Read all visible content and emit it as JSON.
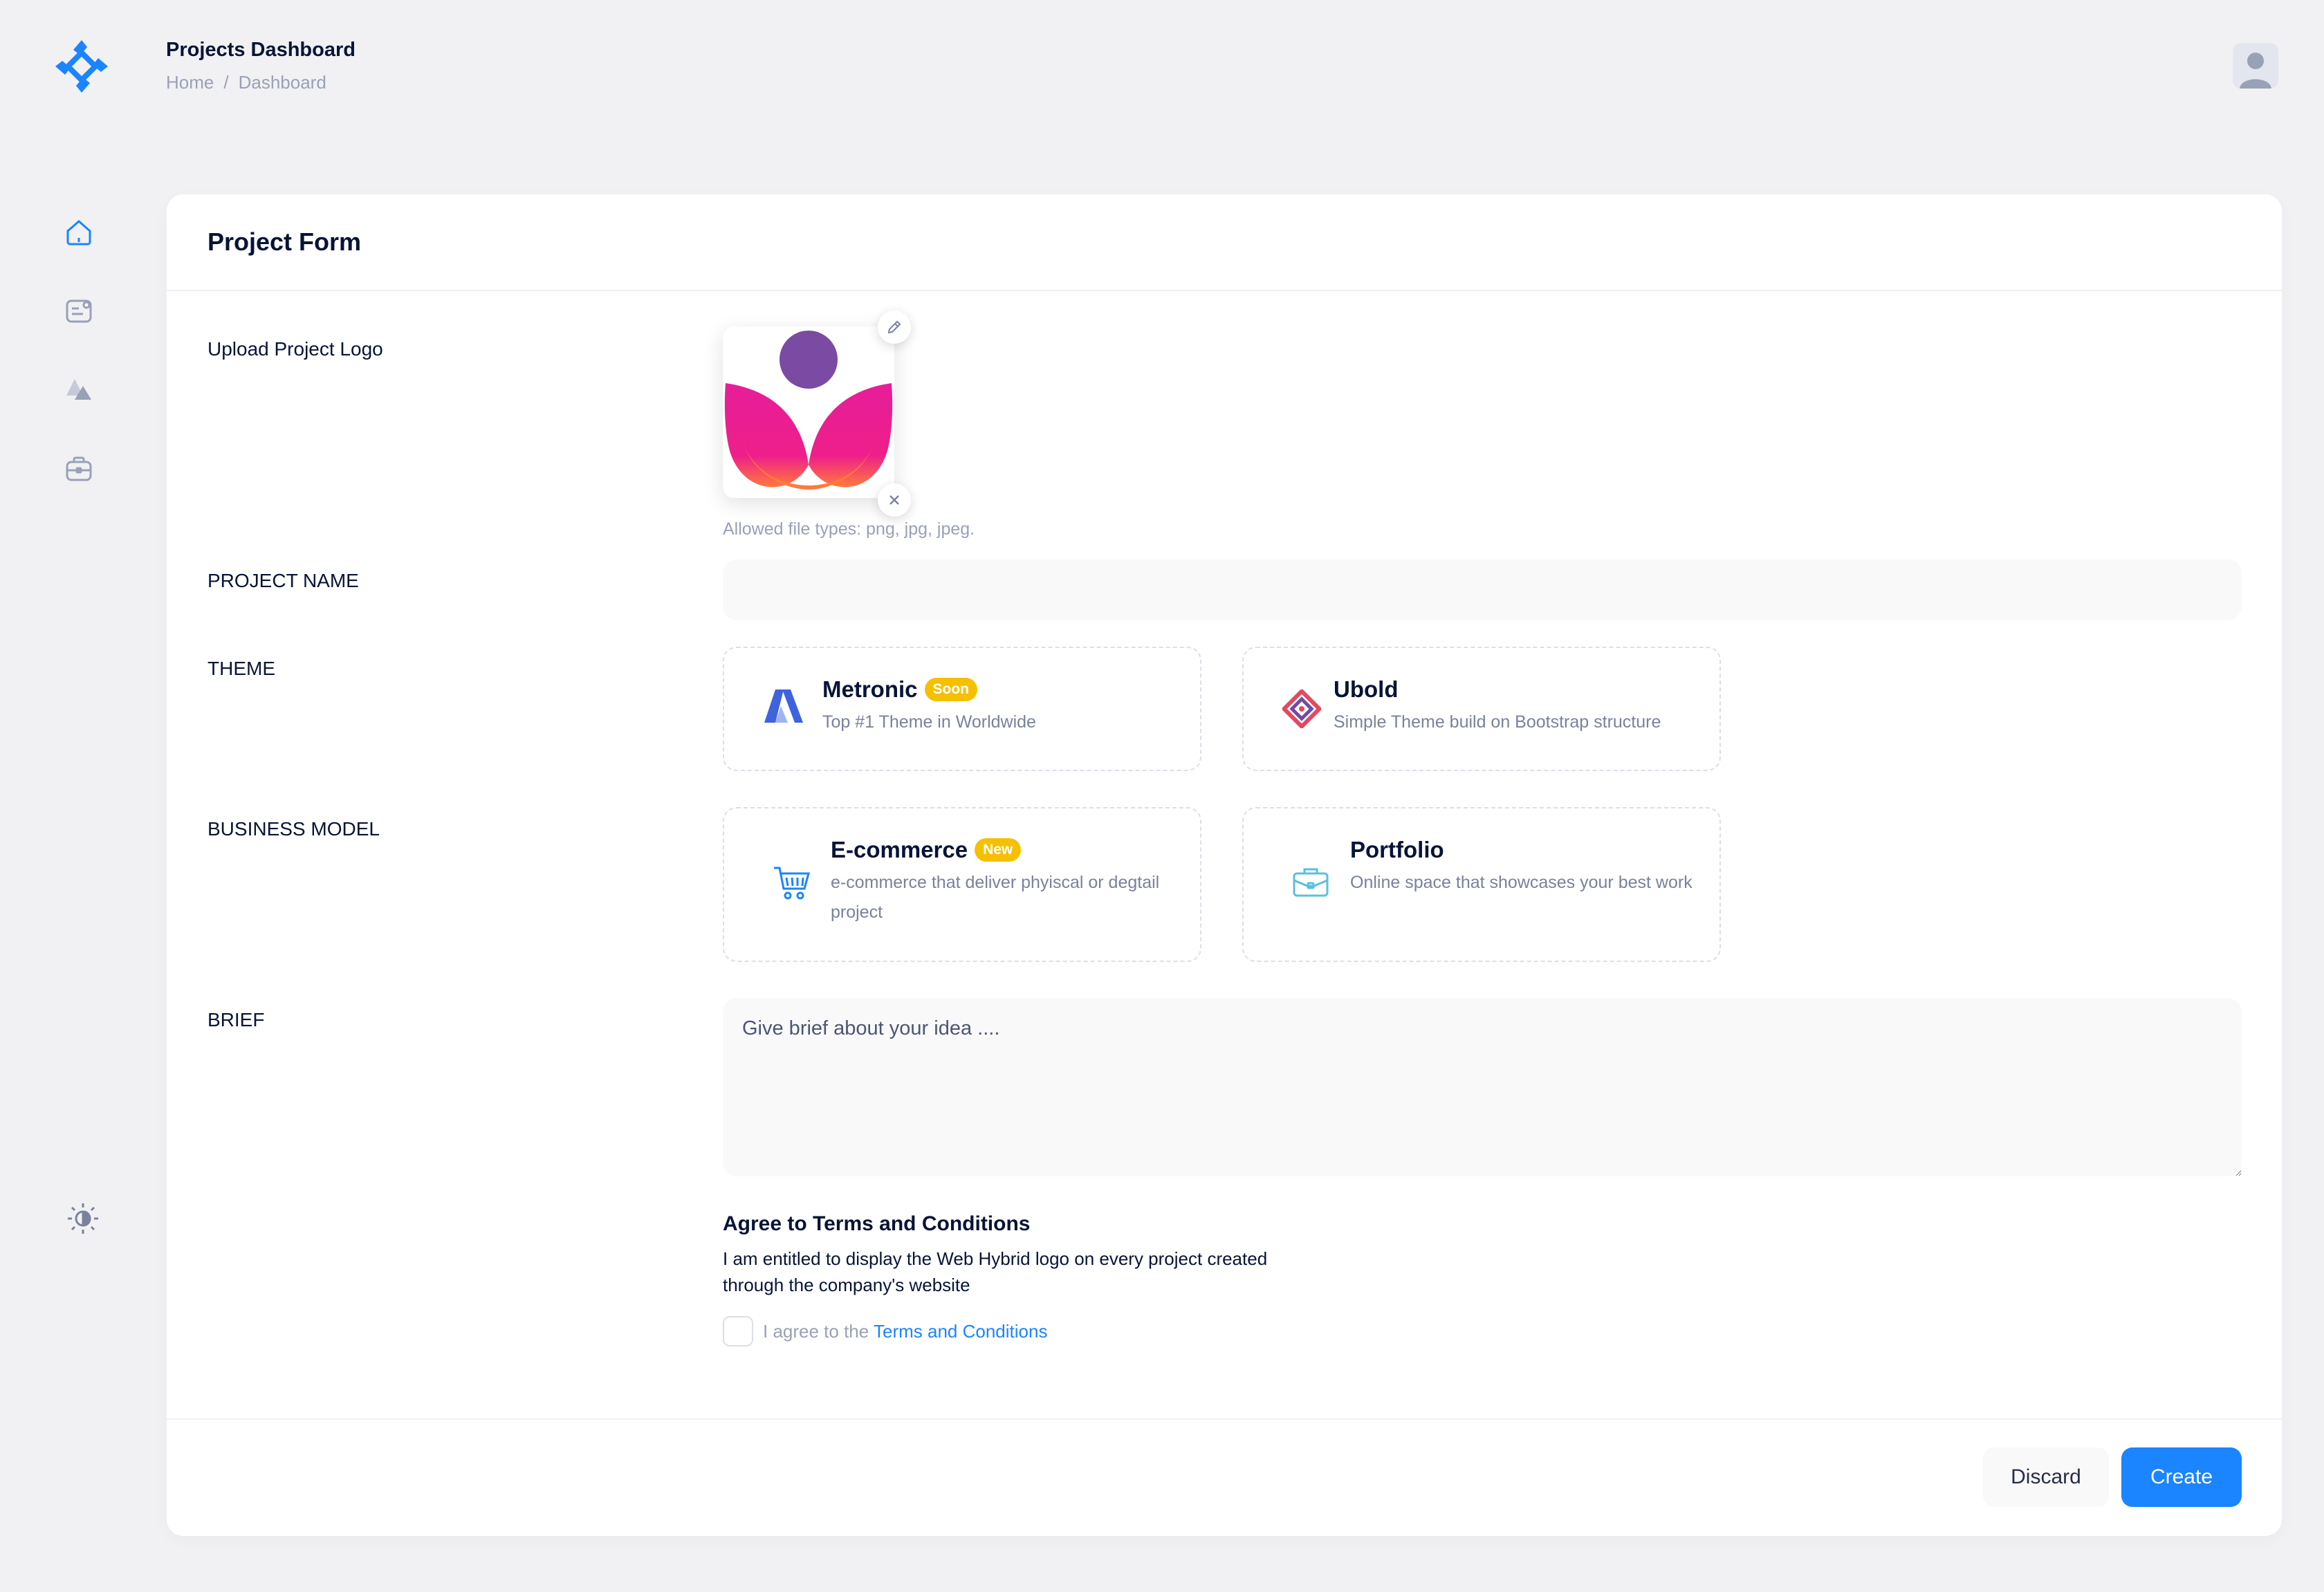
{
  "header": {
    "title": "Projects Dashboard",
    "breadcrumb": [
      "Home",
      "/",
      "Dashboard"
    ]
  },
  "sidebar": {
    "icons": [
      "home-icon",
      "profile-card-icon",
      "shapes-icon",
      "briefcase-icon"
    ],
    "theme_toggle_icon": "sun-icon"
  },
  "form": {
    "title": "Project Form",
    "upload": {
      "label": "Upload Project Logo",
      "hint": "Allowed file types: png, jpg, jpeg."
    },
    "project_name": {
      "label": "PROJECT NAME",
      "value": "",
      "placeholder": ""
    },
    "theme": {
      "label": "THEME",
      "options": [
        {
          "name": "Metronic",
          "badge": "Soon",
          "description": "Top #1 Theme in Worldwide",
          "icon": "metronic-logo-icon"
        },
        {
          "name": "Ubold",
          "badge": "",
          "description": "Simple Theme build on Bootstrap structure",
          "icon": "ubold-logo-icon"
        }
      ]
    },
    "business_model": {
      "label": "BUSINESS MODEL",
      "options": [
        {
          "name": "E-commerce",
          "badge": "New",
          "description": "e-commerce that deliver phyiscal or degtail project",
          "icon": "shopping-cart-icon"
        },
        {
          "name": "Portfolio",
          "badge": "",
          "description": "Online space that showcases your best work",
          "icon": "briefcase-icon"
        }
      ]
    },
    "brief": {
      "label": "BRIEF",
      "placeholder": "Give brief about your idea ...."
    },
    "terms": {
      "title": "Agree to Terms and Conditions",
      "text": "I am entitled to display the Web Hybrid logo on every project created through the company's website",
      "checkbox_prefix": "I agree to the ",
      "checkbox_link": "Terms and Conditions",
      "checked": false
    },
    "buttons": {
      "discard": "Discard",
      "create": "Create"
    }
  },
  "colors": {
    "primary": "#1b84ff",
    "badge": "#f6c000",
    "background": "#f1f1f4",
    "text": "#071437",
    "muted": "#99a1b7"
  }
}
